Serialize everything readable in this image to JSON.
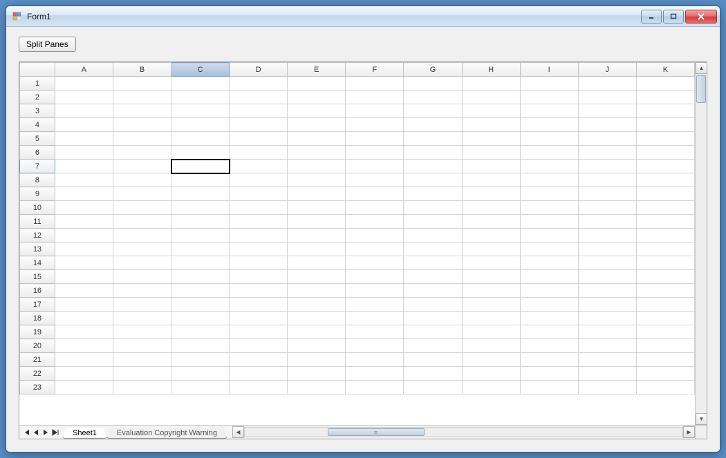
{
  "window": {
    "title": "Form1"
  },
  "toolbar": {
    "split_panes_label": "Split Panes"
  },
  "spreadsheet": {
    "columns": [
      "A",
      "B",
      "C",
      "D",
      "E",
      "F",
      "G",
      "H",
      "I",
      "J",
      "K"
    ],
    "visible_rows": 23,
    "selected_col": "C",
    "selected_row": 7,
    "active_cell": {
      "col": "C",
      "row": 7
    }
  },
  "tabs": {
    "items": [
      "Sheet1",
      "Evaluation Copyright Warning"
    ],
    "active_index": 0
  },
  "nav": {
    "first": "◄◄",
    "prev": "◄",
    "next": "►",
    "last": "►►"
  },
  "scroll_thumb_grip": "≡"
}
